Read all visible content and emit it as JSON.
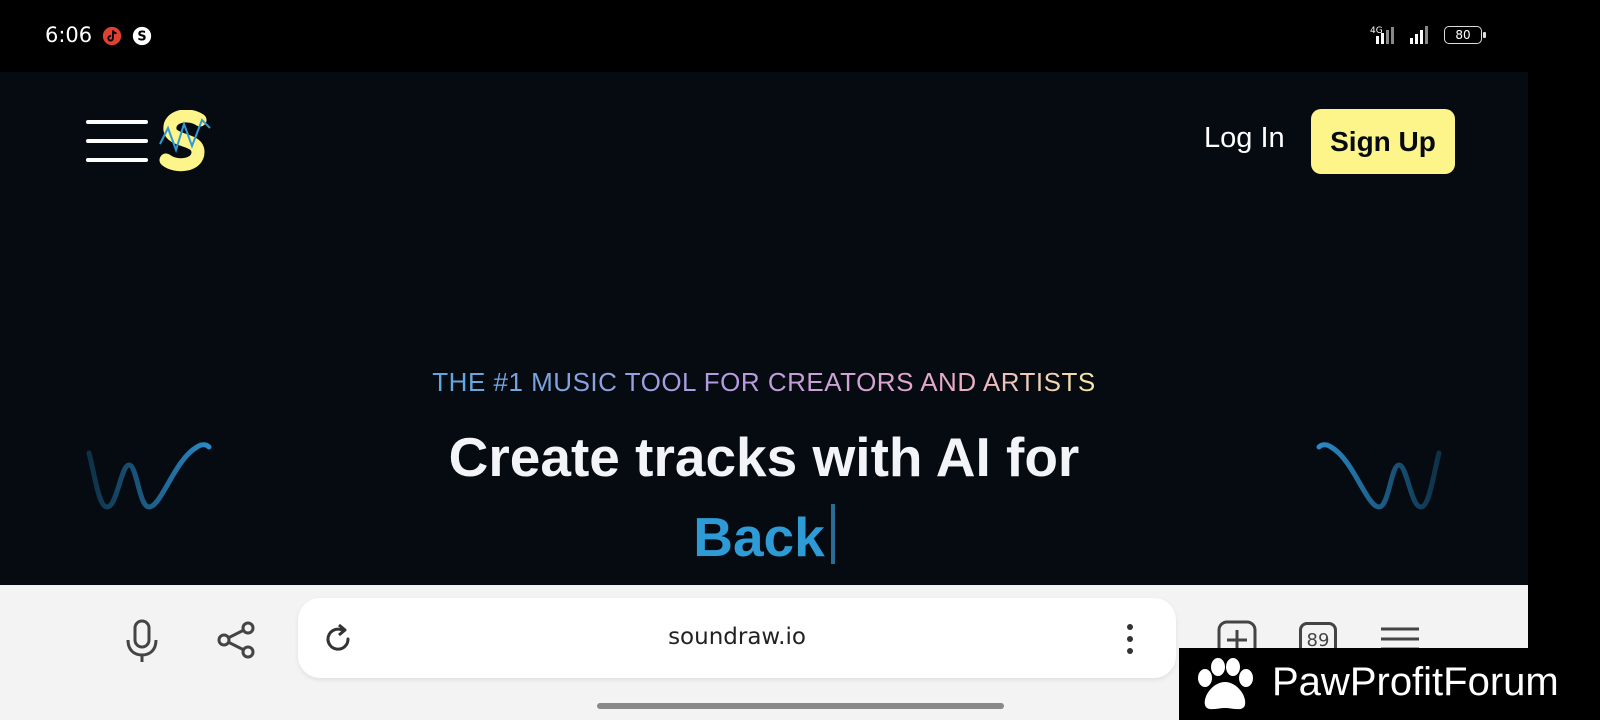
{
  "status_bar": {
    "time": "6:06",
    "battery": "80",
    "network": "4G",
    "icons": [
      "tiktok-icon",
      "app-s-icon",
      "signal-icon",
      "battery-icon"
    ]
  },
  "site": {
    "nav": {
      "login_label": "Log In",
      "signup_label": "Sign Up"
    },
    "hero": {
      "tagline": "THE #1 MUSIC TOOL FOR CREATORS AND ARTISTS",
      "headline": "Create tracks with AI for",
      "highlight": "Back"
    },
    "colors": {
      "background": "#060b12",
      "signup_bg": "#fdf48a",
      "highlight": "#2e9bd6"
    }
  },
  "browser": {
    "url": "soundraw.io",
    "tab_count": "89"
  },
  "watermark": {
    "text": "PawProfitForum"
  }
}
